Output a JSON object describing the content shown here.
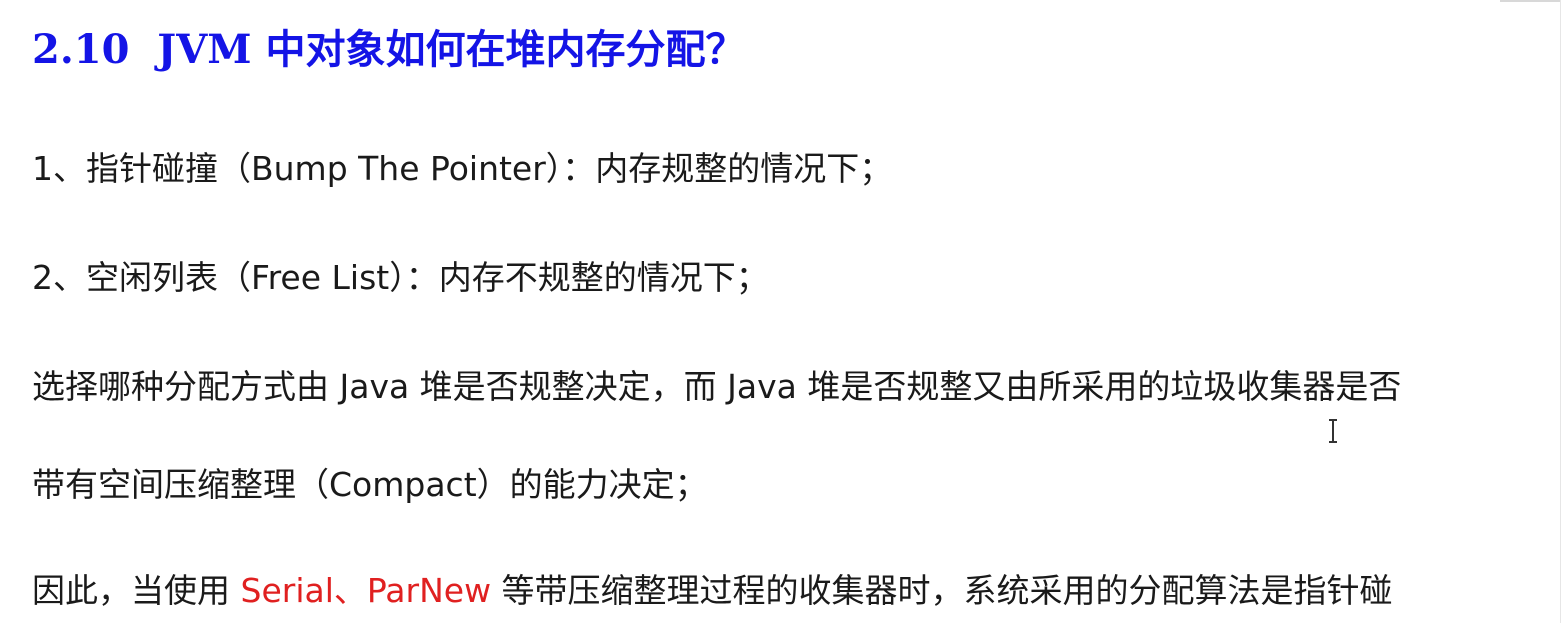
{
  "heading": {
    "number": "2.10",
    "title": "JVM 中对象如何在堆内存分配？"
  },
  "paragraphs": {
    "p1": "1、指针碰撞（Bump The Pointer）：内存规整的情况下；",
    "p2": "2、空闲列表（Free List）：内存不规整的情况下；",
    "p3": "选择哪种分配方式由 Java 堆是否规整决定，而 Java 堆是否规整又由所采用的垃圾收集器是否",
    "p4": "带有空间压缩整理（Compact）的能力决定；",
    "p5": {
      "before": "因此，当使用 ",
      "highlight": "Serial、ParNew",
      "after": " 等带压缩整理过程的收集器时，系统采用的分配算法是指针碰"
    }
  },
  "colors": {
    "heading": "#1414e6",
    "highlight": "#e02020",
    "text": "#1a1a1a",
    "background": "#ffffff"
  },
  "icons": {
    "cursor": "text-cursor-icon"
  }
}
